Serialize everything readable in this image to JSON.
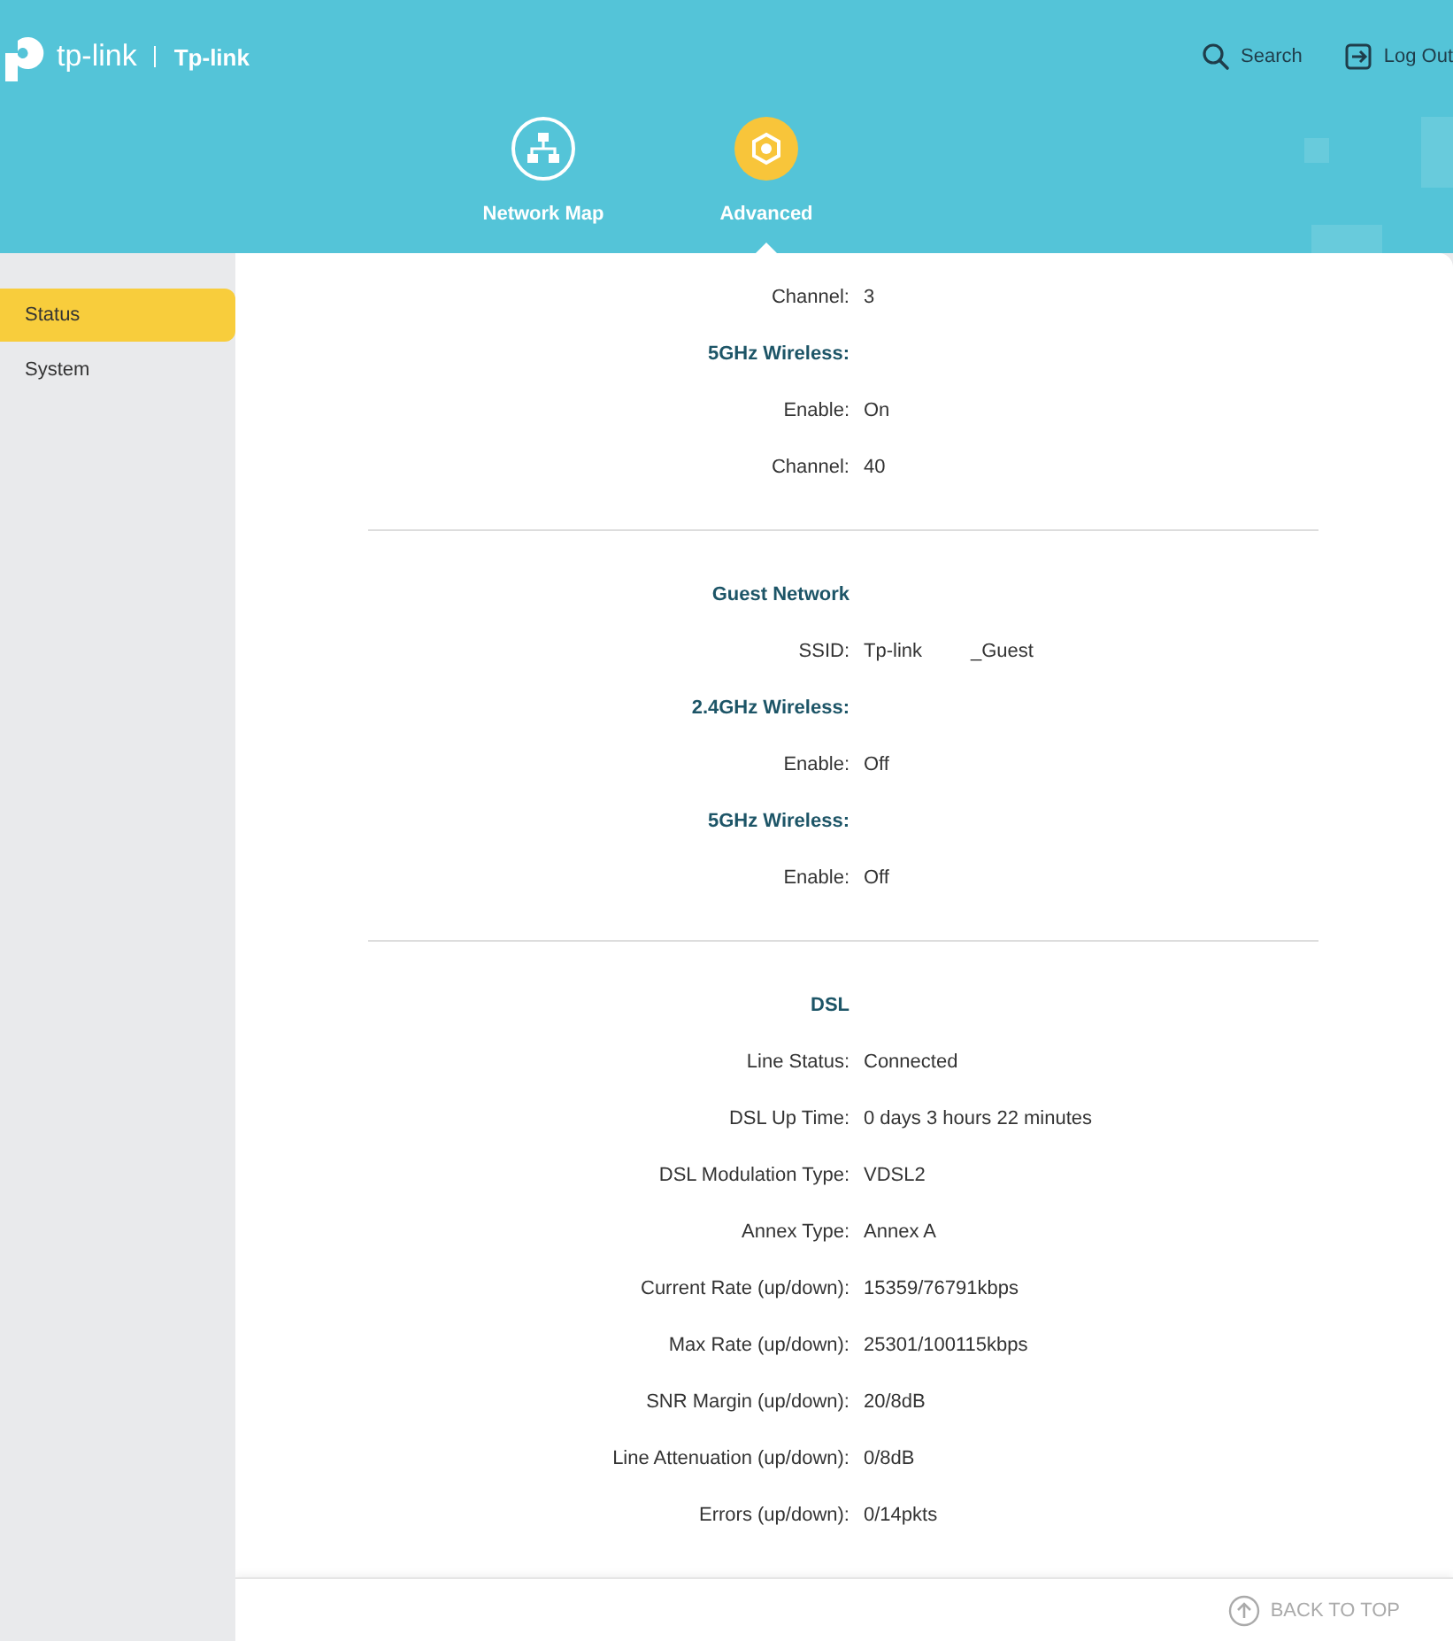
{
  "header": {
    "brand": "tp-link",
    "device_name": "Tp-link",
    "actions": [
      {
        "kind": "search",
        "label": "Search"
      },
      {
        "kind": "logout",
        "label": "Log Out"
      }
    ]
  },
  "nav_tabs": [
    {
      "kind": "network",
      "label": "Network Map",
      "selected": false
    },
    {
      "kind": "advanced",
      "label": "Advanced",
      "selected": true
    }
  ],
  "sidebar": {
    "items": [
      {
        "label": "Status",
        "selected": true
      },
      {
        "label": "System",
        "selected": false
      }
    ]
  },
  "sections": [
    {
      "rows": [
        {
          "kind": "field",
          "label": "Channel:",
          "value": "3"
        },
        {
          "kind": "heading",
          "label": "5GHz Wireless:"
        },
        {
          "kind": "field",
          "label": "Enable:",
          "value": "On"
        },
        {
          "kind": "field",
          "label": "Channel:",
          "value": "40"
        }
      ]
    },
    {
      "rows": [
        {
          "kind": "heading",
          "label": "Guest Network"
        },
        {
          "kind": "field",
          "label": "SSID:",
          "value": "Tp-link         _Guest"
        },
        {
          "kind": "heading",
          "label": "2.4GHz Wireless:"
        },
        {
          "kind": "field",
          "label": "Enable:",
          "value": "Off"
        },
        {
          "kind": "heading",
          "label": "5GHz Wireless:"
        },
        {
          "kind": "field",
          "label": "Enable:",
          "value": "Off"
        }
      ]
    },
    {
      "rows": [
        {
          "kind": "heading",
          "label": "DSL"
        },
        {
          "kind": "field",
          "label": "Line Status:",
          "value": "Connected"
        },
        {
          "kind": "field",
          "label": "DSL Up Time:",
          "value": "0 days 3 hours 22 minutes"
        },
        {
          "kind": "field",
          "label": "DSL Modulation Type:",
          "value": "VDSL2"
        },
        {
          "kind": "field",
          "label": "Annex Type:",
          "value": "Annex A"
        },
        {
          "kind": "field",
          "label": "Current Rate (up/down):",
          "value": "15359/76791kbps"
        },
        {
          "kind": "field",
          "label": "Max Rate (up/down):",
          "value": "25301/100115kbps"
        },
        {
          "kind": "field",
          "label": "SNR Margin (up/down):",
          "value": "20/8dB"
        },
        {
          "kind": "field",
          "label": "Line Attenuation (up/down):",
          "value": "0/8dB"
        },
        {
          "kind": "field",
          "label": "Errors (up/down):",
          "value": "0/14pkts"
        }
      ]
    }
  ],
  "footer": {
    "back_to_top": "BACK TO TOP"
  }
}
